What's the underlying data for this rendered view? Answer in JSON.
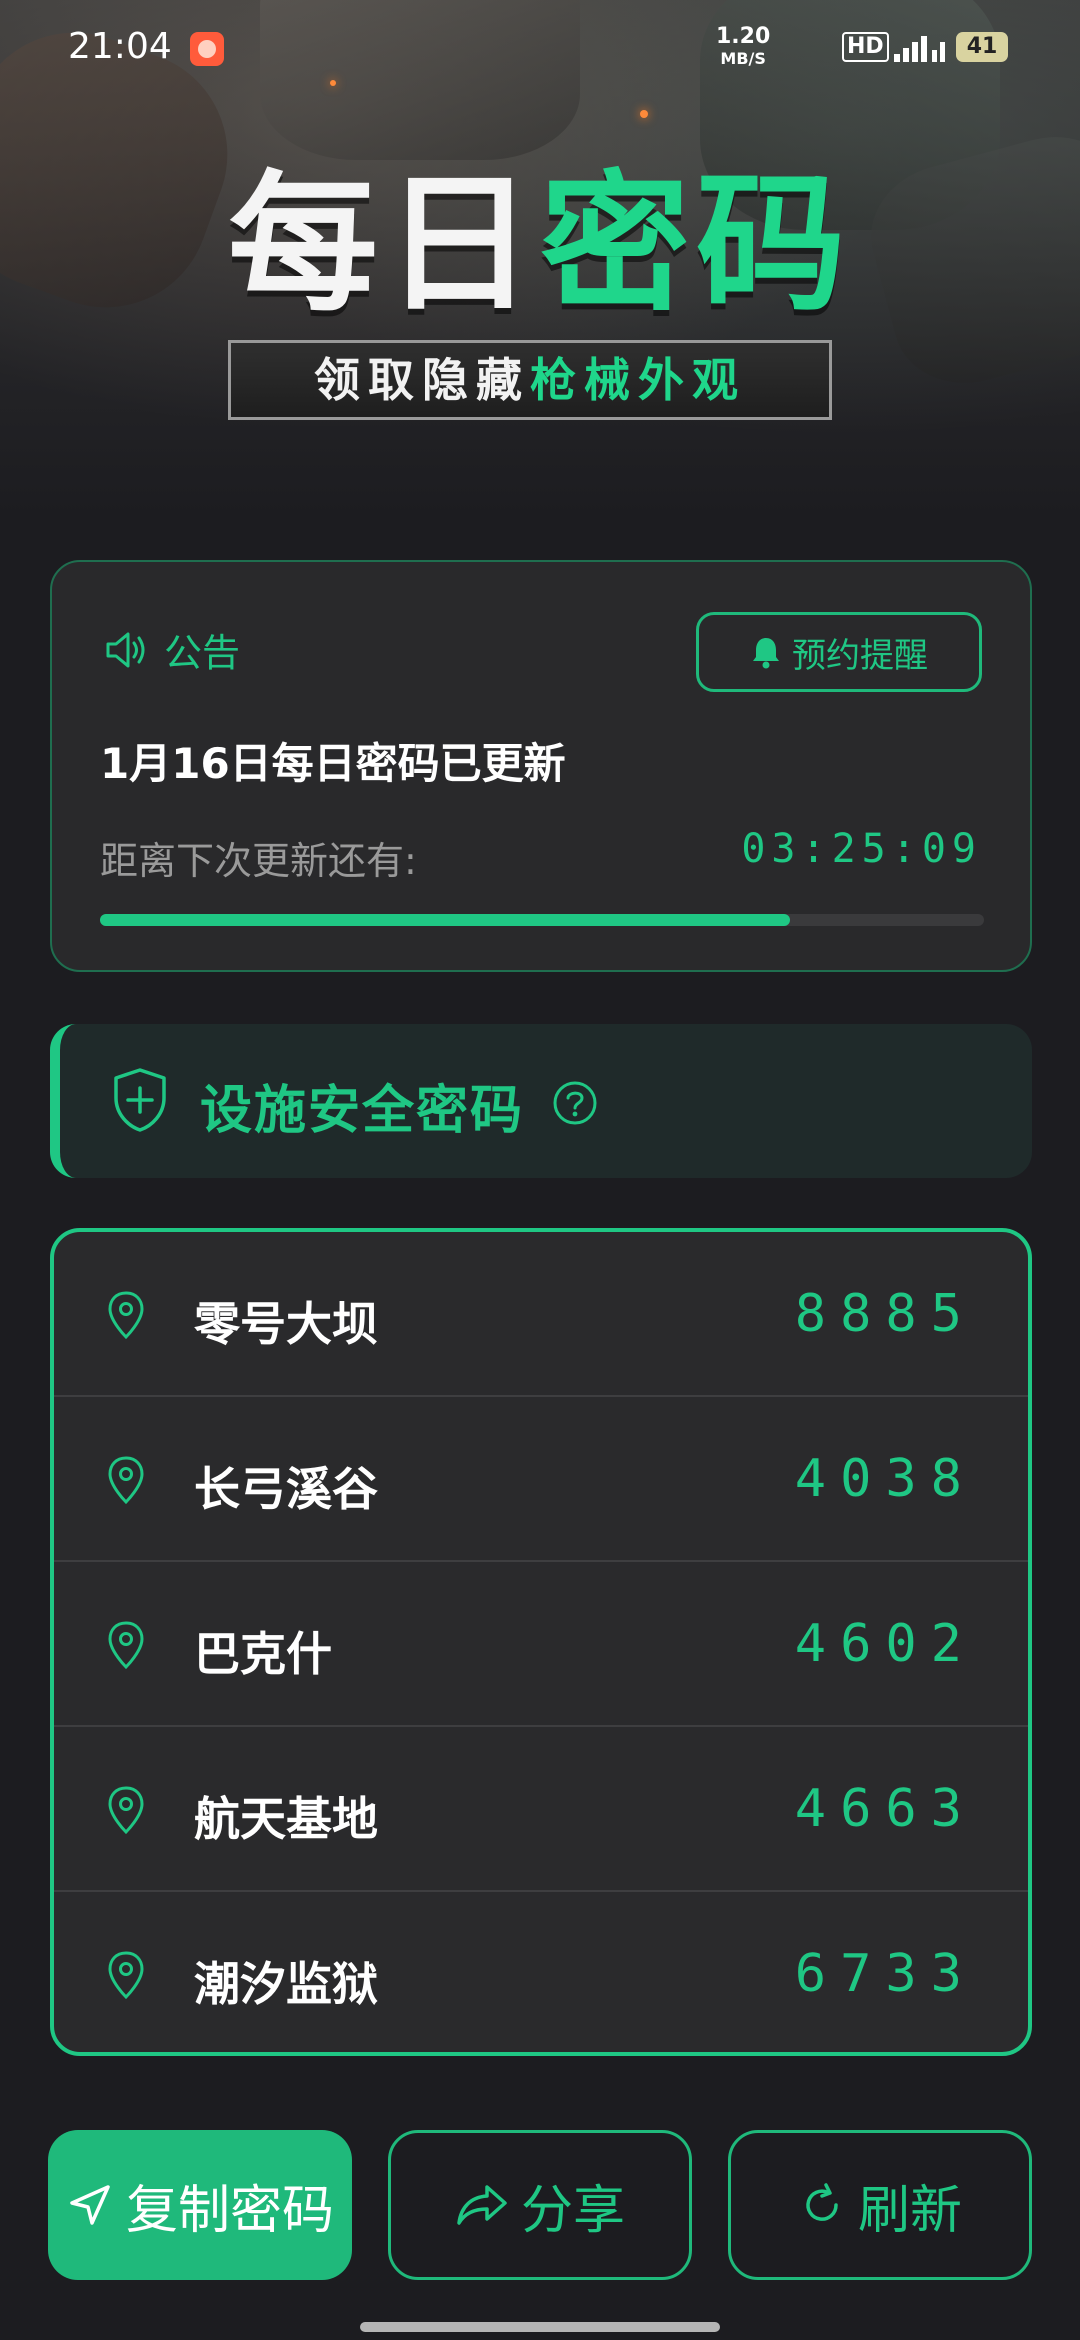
{
  "status_bar": {
    "time": "21:04",
    "net_speed_value": "1.20",
    "net_speed_unit": "MB/S",
    "hd": "HD",
    "battery": "41"
  },
  "hero": {
    "title_white": "每日",
    "title_green": "密码",
    "subtitle_white": "领取隐藏",
    "subtitle_green": "枪械外观"
  },
  "announcement": {
    "label": "公告",
    "remind_button": "预约提醒",
    "title": "1月16日每日密码已更新",
    "countdown_label": "距离下次更新还有:",
    "countdown": "03:25:09",
    "progress": 0.78
  },
  "section": {
    "title": "设施安全密码"
  },
  "codes": [
    {
      "name": "零号大坝",
      "code": "8885"
    },
    {
      "name": "长弓溪谷",
      "code": "4038"
    },
    {
      "name": "巴克什",
      "code": "4602"
    },
    {
      "name": "航天基地",
      "code": "4663"
    },
    {
      "name": "潮汐监狱",
      "code": "6733"
    }
  ],
  "actions": {
    "copy": "复制密码",
    "share": "分享",
    "refresh": "刷新"
  },
  "colors": {
    "accent": "#1fc784",
    "background": "#1c1c20",
    "card": "#2a2a2c"
  }
}
